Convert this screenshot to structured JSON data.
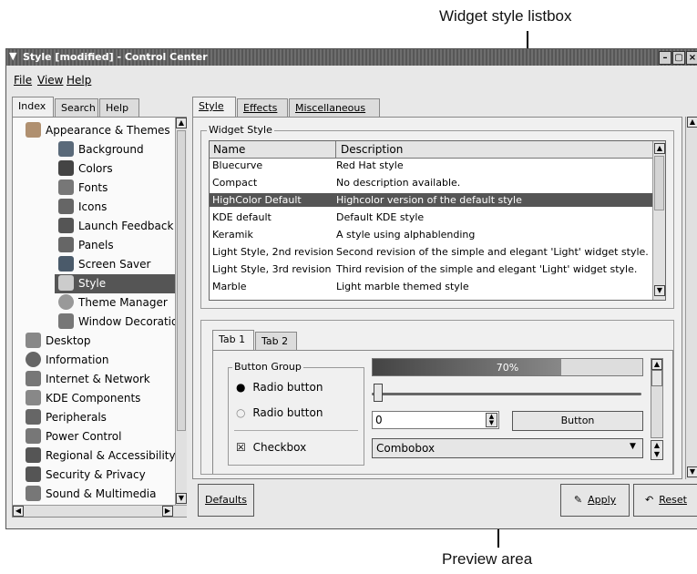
{
  "callouts": {
    "top": "Widget style listbox",
    "bottom": "Preview area"
  },
  "window": {
    "title": "Style [modified] - Control Center",
    "menu": [
      "File",
      "View",
      "Help"
    ]
  },
  "left_tabs": [
    "Index",
    "Search",
    "Help"
  ],
  "tree": {
    "root": "Appearance & Themes",
    "children": [
      "Background",
      "Colors",
      "Fonts",
      "Icons",
      "Launch Feedback",
      "Panels",
      "Screen Saver",
      "Style",
      "Theme Manager",
      "Window Decorations"
    ],
    "selected": "Style",
    "top_level": [
      "Desktop",
      "Information",
      "Internet & Network",
      "KDE Components",
      "Peripherals",
      "Power Control",
      "Regional & Accessibility",
      "Security & Privacy",
      "Sound & Multimedia"
    ]
  },
  "right_tabs": [
    "Style",
    "Effects",
    "Miscellaneous"
  ],
  "widget_style": {
    "group_label": "Widget Style",
    "columns": [
      "Name",
      "Description"
    ],
    "rows": [
      [
        "Bluecurve",
        "Red Hat style"
      ],
      [
        "Compact",
        "No description available."
      ],
      [
        "HighColor Default",
        "Highcolor version of the default style"
      ],
      [
        "KDE default",
        "Default KDE style"
      ],
      [
        "Keramik",
        "A style using alphablending"
      ],
      [
        "Light Style, 2nd revision",
        "Second revision of the simple and elegant 'Light' widget style."
      ],
      [
        "Light Style, 3rd revision",
        "Third revision of the simple and elegant 'Light' widget style."
      ],
      [
        "Marble",
        "Light marble themed style"
      ]
    ],
    "selected_index": 2
  },
  "preview": {
    "tabs": [
      "Tab 1",
      "Tab 2"
    ],
    "button_group_label": "Button Group",
    "radio1": "Radio button",
    "radio2": "Radio button",
    "checkbox": "Checkbox",
    "progress_text": "70%",
    "progress_value": 0.7,
    "spin_value": "0",
    "button": "Button",
    "combobox": "Combobox"
  },
  "bottom_buttons": {
    "defaults": "Defaults",
    "apply": "Apply",
    "reset": "Reset"
  },
  "colors": {
    "selection": "#555555",
    "progress": "#6a6a6a"
  }
}
